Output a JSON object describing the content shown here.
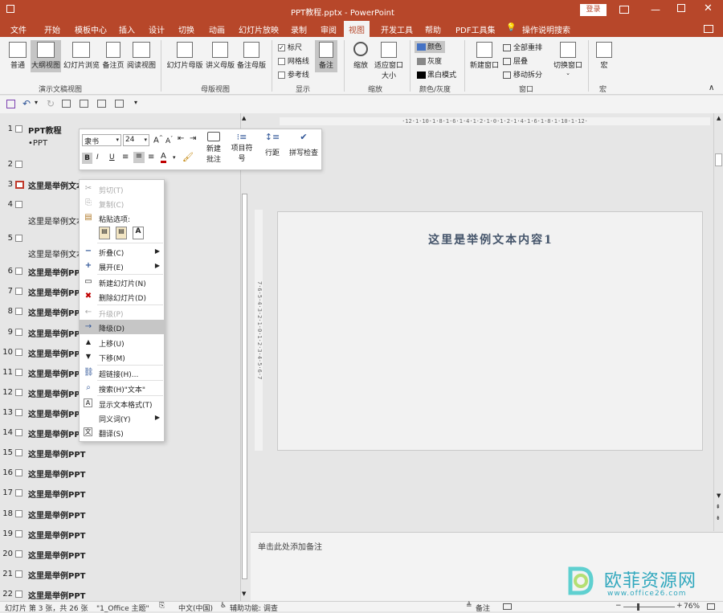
{
  "titlebar": {
    "title": "PPT教程.pptx  -  PowerPoint",
    "login": "登录"
  },
  "tabs": [
    "文件",
    "开始",
    "模板中心",
    "插入",
    "设计",
    "切换",
    "动画",
    "幻灯片放映",
    "录制",
    "审阅",
    "视图",
    "开发工具",
    "帮助",
    "PDF工具集",
    "操作说明搜索"
  ],
  "ribbon": {
    "buttons": [
      "普通",
      "大纲视图",
      "幻灯片浏览",
      "备注页",
      "阅读视图",
      "幻灯片母版",
      "讲义母版",
      "备注母版",
      "备注",
      "缩放",
      "适应窗口大小",
      "新建窗口",
      "切换窗口",
      "宏"
    ],
    "checks": [
      "标尺",
      "网格线",
      "参考线"
    ],
    "color_items": [
      "颜色",
      "灰度",
      "黑白模式"
    ],
    "window_items": [
      "全部重排",
      "层叠",
      "移动拆分"
    ],
    "groups": [
      "演示文稿视图",
      "母版视图",
      "显示",
      "缩放",
      "颜色/灰度",
      "窗口",
      "宏"
    ]
  },
  "outline": {
    "rows": [
      {
        "num": "1",
        "text": "PPT教程"
      },
      {
        "num": "",
        "text": "•PPT"
      },
      {
        "num": "2",
        "text": ""
      },
      {
        "num": "3",
        "text": "这里是举例文本内容1"
      },
      {
        "num": "4",
        "text": ""
      },
      {
        "num": "",
        "text": "这里是举例文本"
      },
      {
        "num": "5",
        "text": ""
      },
      {
        "num": "",
        "text": "这里是举例文本"
      },
      {
        "num": "6",
        "text": "这里是举例PPT"
      },
      {
        "num": "7",
        "text": "这里是举例PPT"
      },
      {
        "num": "8",
        "text": "这里是举例PPT"
      },
      {
        "num": "9",
        "text": "这里是举例PPT"
      },
      {
        "num": "10",
        "text": "这里是举例PPT"
      },
      {
        "num": "11",
        "text": "这里是举例PPT"
      },
      {
        "num": "12",
        "text": "这里是举例PPT"
      },
      {
        "num": "13",
        "text": "这里是举例PPT"
      },
      {
        "num": "14",
        "text": "这里是举例PPT"
      },
      {
        "num": "15",
        "text": "这里是举例PPT"
      },
      {
        "num": "16",
        "text": "这里是举例PPT"
      },
      {
        "num": "17",
        "text": "这里是举例PPT"
      },
      {
        "num": "18",
        "text": "这里是举例PPT"
      },
      {
        "num": "19",
        "text": "这里是举例PPT"
      },
      {
        "num": "20",
        "text": "这里是举例PPT"
      },
      {
        "num": "21",
        "text": "这里是举例PPT"
      },
      {
        "num": "22",
        "text": "这里是举例PPT"
      }
    ]
  },
  "minibar": {
    "font": "隶书",
    "size": "24",
    "new_comment": "新建批注",
    "bullets": "项目符号",
    "line_spacing": "行距",
    "spell_check": "拼写检查"
  },
  "context_menu": [
    {
      "label": "剪切(T)",
      "disabled": true,
      "icon": "✂"
    },
    {
      "label": "复制(C)",
      "disabled": true,
      "icon": "⎘"
    },
    {
      "label": "粘贴选项:",
      "disabled": false,
      "icon": "📋"
    },
    {
      "label": "折叠(C)",
      "disabled": false,
      "icon": "−",
      "sub": true
    },
    {
      "label": "展开(E)",
      "disabled": false,
      "icon": "+",
      "sub": true
    },
    {
      "label": "新建幻灯片(N)",
      "disabled": false,
      "icon": "▭"
    },
    {
      "label": "删除幻灯片(D)",
      "disabled": false,
      "icon": "✖"
    },
    {
      "label": "升级(P)",
      "disabled": true,
      "icon": "←"
    },
    {
      "label": "降级(D)",
      "disabled": false,
      "icon": "→",
      "highlight": true
    },
    {
      "label": "上移(U)",
      "disabled": false,
      "icon": "▲"
    },
    {
      "label": "下移(M)",
      "disabled": false,
      "icon": "▼"
    },
    {
      "label": "超链接(H)...",
      "disabled": false,
      "icon": "🔗"
    },
    {
      "label": "搜索(H)\"文本\"",
      "disabled": false,
      "icon": "⌕"
    },
    {
      "label": "显示文本格式(T)",
      "disabled": false,
      "icon": "A"
    },
    {
      "label": "同义词(Y)",
      "disabled": false,
      "icon": "",
      "sub": true
    },
    {
      "label": "翻译(S)",
      "disabled": false,
      "icon": "文"
    }
  ],
  "slide": {
    "title": "这里是举例文本内容1"
  },
  "notes": {
    "placeholder": "单击此处添加备注"
  },
  "status": {
    "slide_info": "幻灯片 第 3 张，共 26 张",
    "theme": "\"1_Office 主题\"",
    "lang": "中文(中国)",
    "access": "辅助功能: 调查",
    "notes": "备注",
    "zoom": "76%"
  },
  "watermark": {
    "text": "欧菲资源网",
    "url": "www.office26.com"
  },
  "ruler": {
    "h": "·12·1·10·1·8·1·6·1·4·1·2·1·0·1·2·1·4·1·6·1·8·1·10·1·12·",
    "v": "7·6·5·4·3·2·1·0·1·2·3·4·5·6·7"
  },
  "colors": {
    "accent": "#b7472a"
  }
}
